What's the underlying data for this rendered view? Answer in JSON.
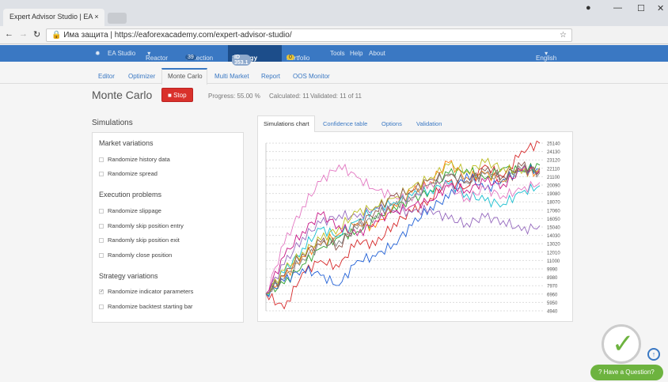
{
  "browser": {
    "tab_title": "Expert Advisor Studio | EA",
    "security": "Има защита",
    "url": "https://eaforexacademy.com/expert-advisor-studio/"
  },
  "nav": {
    "items": [
      "EA Studio",
      "Reactor",
      "Collection",
      "Strategy",
      "Portfolio",
      "Tools",
      "Help",
      "About"
    ],
    "collection_count": "39",
    "strategy_id": "ID 353.1",
    "portfolio_count": "0",
    "language": "English"
  },
  "subtabs": [
    "Editor",
    "Optimizer",
    "Monte Carlo",
    "Multi Market",
    "Report",
    "OOS Monitor"
  ],
  "page": {
    "title": "Monte Carlo",
    "stop_label": "Stop",
    "progress": "Progress: 55.00 %",
    "calculated": "Calculated: 11",
    "validated": "Validated: 11 of 11"
  },
  "simulations": {
    "title": "Simulations",
    "groups": [
      {
        "title": "Market variations",
        "items": [
          {
            "label": "Randomize history data",
            "checked": false
          },
          {
            "label": "Randomize spread",
            "checked": false
          }
        ]
      },
      {
        "title": "Execution problems",
        "items": [
          {
            "label": "Randomize slippage",
            "checked": false
          },
          {
            "label": "Randomly skip position entry",
            "checked": false
          },
          {
            "label": "Randomly skip position exit",
            "checked": false
          },
          {
            "label": "Randomly close position",
            "checked": false
          }
        ]
      },
      {
        "title": "Strategy variations",
        "items": [
          {
            "label": "Randomize indicator parameters",
            "checked": true
          },
          {
            "label": "Randomize backtest starting bar",
            "checked": false
          }
        ]
      }
    ]
  },
  "chart_tabs": [
    "Simulations chart",
    "Confidence table",
    "Options",
    "Validation"
  ],
  "help": {
    "label": "Have a Question?"
  },
  "chart_data": {
    "type": "line",
    "ylim": [
      4940,
      25140
    ],
    "yticks": [
      25140,
      24130,
      23120,
      22110,
      21100,
      20090,
      19080,
      18070,
      17060,
      16050,
      15040,
      14030,
      13020,
      12010,
      11000,
      9990,
      8980,
      7970,
      6960,
      5950,
      4940
    ],
    "series": [
      {
        "color": "#d62728",
        "values": [
          7000,
          5200,
          9500,
          11000,
          10200,
          13500,
          12800,
          15500,
          16800,
          18500,
          20500,
          19800,
          22500,
          21000,
          24200,
          25140
        ]
      },
      {
        "color": "#2ca02c",
        "values": [
          7000,
          8200,
          10500,
          12500,
          13800,
          14500,
          16000,
          17500,
          18200,
          19500,
          21500,
          22000,
          20800,
          22200,
          21800,
          22500
        ]
      },
      {
        "color": "#ff7f0e",
        "values": [
          7000,
          9000,
          11500,
          13000,
          14200,
          15500,
          15000,
          17800,
          19200,
          20500,
          22800,
          21000,
          21500,
          20500,
          22000,
          21500
        ]
      },
      {
        "color": "#1f5fd6",
        "values": [
          7000,
          8500,
          10000,
          9200,
          8000,
          11000,
          11500,
          13000,
          15200,
          17500,
          18500,
          21500,
          19500,
          20800,
          21800,
          22000
        ]
      },
      {
        "color": "#17becf",
        "values": [
          7000,
          9500,
          12500,
          14800,
          14000,
          15800,
          17200,
          18000,
          18800,
          19500,
          20200,
          19000,
          18200,
          17800,
          19200,
          20000
        ]
      },
      {
        "color": "#e377c2",
        "values": [
          7000,
          13000,
          17500,
          20500,
          22500,
          21000,
          19500,
          18800,
          18200,
          20500,
          19800,
          18500,
          19600,
          18800,
          19500,
          20400
        ]
      },
      {
        "color": "#9467bd",
        "values": [
          7000,
          10500,
          13800,
          15500,
          16500,
          16200,
          17400,
          17000,
          16800,
          17200,
          16000,
          15500,
          16200,
          15800,
          14600,
          15200
        ]
      },
      {
        "color": "#bcbd22",
        "values": [
          7000,
          9800,
          12000,
          13500,
          15000,
          16800,
          17500,
          18500,
          19800,
          21000,
          22500,
          21800,
          22800,
          22200,
          21500,
          22200
        ]
      },
      {
        "color": "#c71585",
        "values": [
          7000,
          11500,
          14500,
          16500,
          15200,
          14000,
          15800,
          16800,
          17600,
          18200,
          20000,
          19500,
          20500,
          20200,
          21800,
          22000
        ]
      },
      {
        "color": "#8c564b",
        "values": [
          7000,
          9200,
          11800,
          13200,
          12800,
          15200,
          17000,
          18800,
          19400,
          20800,
          21200,
          20600,
          21800,
          21200,
          22400,
          21800
        ]
      },
      {
        "color": "#7f7f7f",
        "values": [
          7000,
          8800,
          11200,
          12800,
          13400,
          14800,
          16400,
          17600,
          18600,
          20200,
          21400,
          20400,
          21400,
          20800,
          22000,
          21600
        ]
      }
    ]
  }
}
